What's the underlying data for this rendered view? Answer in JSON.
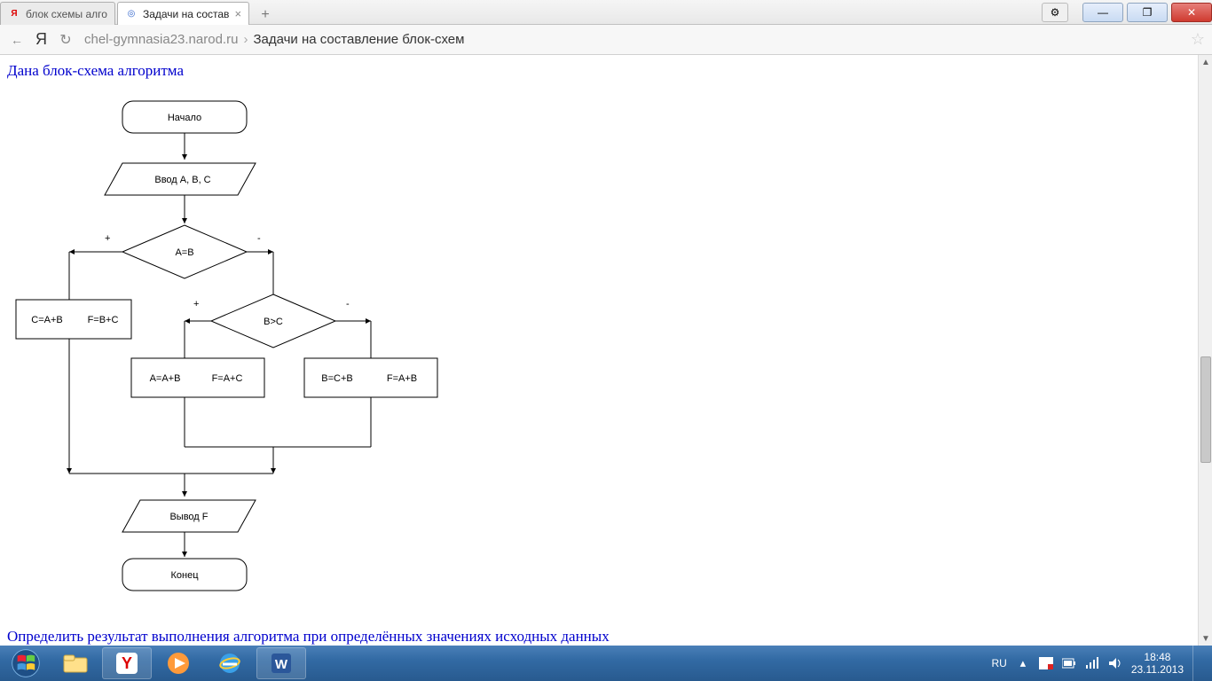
{
  "browser": {
    "tabs": [
      {
        "title": "блок схемы алго",
        "favicon_letter": "Я",
        "favicon_color": "#d00"
      },
      {
        "title": "Задачи на состав",
        "favicon_letter": "◎",
        "favicon_color": "#36c"
      }
    ],
    "newtab_label": "+",
    "address": {
      "domain": "chel-gymnasia23.narod.ru",
      "separator": "›",
      "page": "Задачи на составление блок-схем"
    }
  },
  "page": {
    "heading_top": "Дана блок-схема алгоритма",
    "heading_bottom": "Определить результат выполнения алгоритма при определённых значениях исходных данных"
  },
  "flowchart": {
    "start": "Начало",
    "input": "Ввод A, B, C",
    "cond1": "A=B",
    "cond2": "B>C",
    "box_left_1": "C=A+B",
    "box_left_2": "F=B+C",
    "box_mid_1": "A=A+B",
    "box_mid_2": "F=A+C",
    "box_right_1": "B=C+B",
    "box_right_2": "F=A+B",
    "output": "Вывод F",
    "end": "Конец",
    "plus": "+",
    "minus": "-"
  },
  "windows_controls": {
    "minimize": "—",
    "maximize": "❐",
    "close": "✕",
    "gear": "⚙"
  },
  "taskbar": {
    "lang": "RU",
    "tray_up": "▴",
    "time": "18:48",
    "date": "23.11.2013"
  }
}
